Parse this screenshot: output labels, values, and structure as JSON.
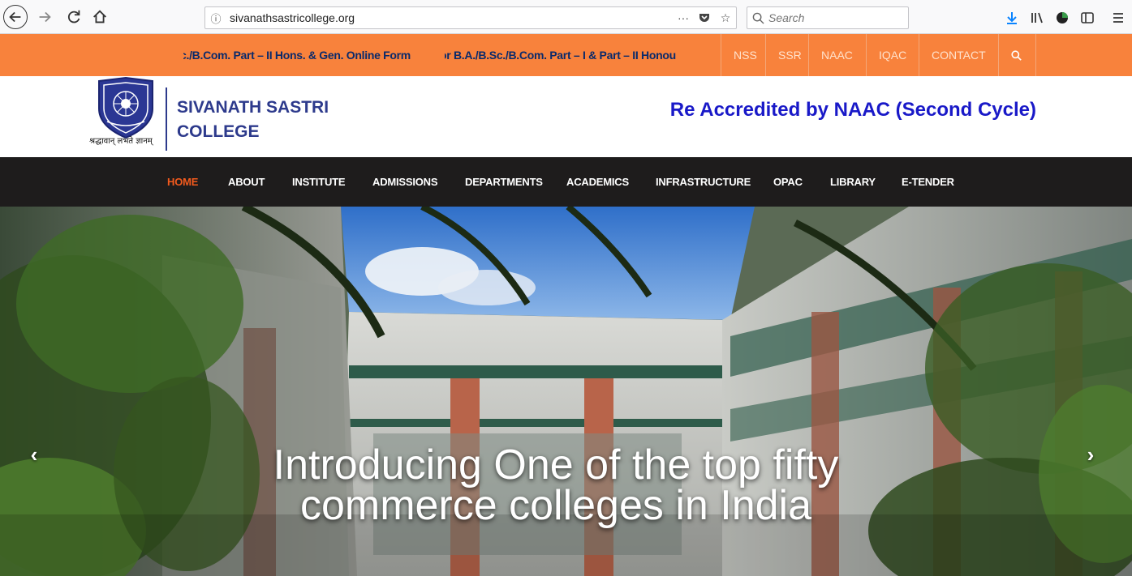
{
  "browser": {
    "url": "sivanathsastricollege.org",
    "search_placeholder": "Search",
    "overflow_label": "···"
  },
  "top_bar": {
    "ticker_1": "c./B.Com. Part – II Hons. & Gen. Online Form",
    "ticker_2": "or B.A./B.Sc./B.Com. Part – I & Part – II Honou",
    "links": [
      "NSS",
      "SSR",
      "NAAC",
      "IQAC",
      "CONTACT"
    ]
  },
  "header": {
    "college_name": "SIVANATH SASTRI COLLEGE",
    "motto": "श्रद्धावान् लभते ज्ञानम्",
    "accreditation": "Re Accredited by NAAC (Second Cycle)"
  },
  "nav": {
    "items": [
      "HOME",
      "ABOUT",
      "INSTITUTE",
      "ADMISSIONS",
      "DEPARTMENTS",
      "ACADEMICS",
      "INFRASTRUCTURE",
      "OPAC",
      "LIBRARY",
      "E-TENDER"
    ],
    "active": "HOME"
  },
  "hero": {
    "caption_line_1": "Introducing One of the top fifty",
    "caption_line_2": "commerce colleges in India",
    "prev_label": "‹",
    "next_label": "›"
  },
  "colors": {
    "top_bar": "#f8823c",
    "nav_bg": "#1e1c1c",
    "nav_active": "#f25a1d",
    "college_name": "#2d3a8c",
    "accreditation": "#1919c8"
  }
}
